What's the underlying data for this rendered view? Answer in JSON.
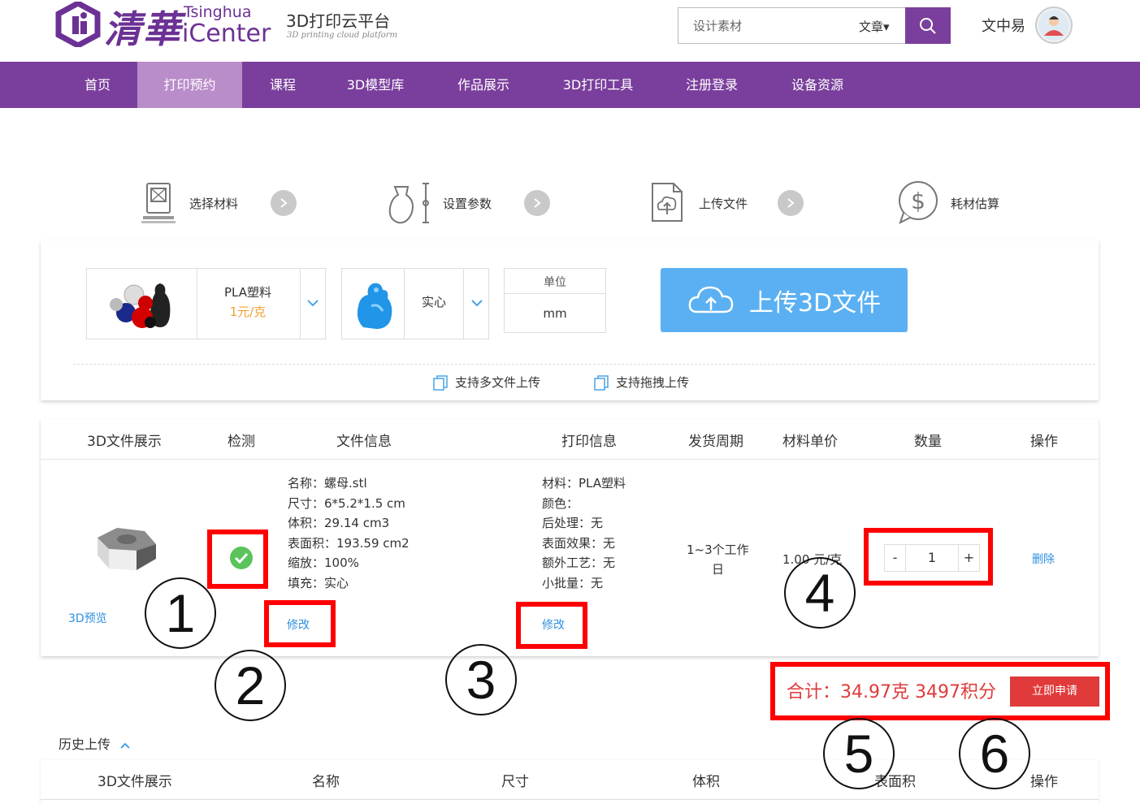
{
  "header": {
    "logo_cn": "清華",
    "logo_en_top": "Tsinghua",
    "logo_en_bottom": "iCenter",
    "platform_title": "3D打印云平台",
    "platform_subtitle": "3D printing cloud platform",
    "search_placeholder": "设计素材",
    "search_category": "文章▾",
    "user_name": "文中易"
  },
  "nav": {
    "items": [
      {
        "label": "首页"
      },
      {
        "label": "打印预约"
      },
      {
        "label": "课程"
      },
      {
        "label": "3D模型库"
      },
      {
        "label": "作品展示"
      },
      {
        "label": "3D打印工具"
      },
      {
        "label": "注册登录"
      },
      {
        "label": "设备资源"
      }
    ],
    "active_index": 1
  },
  "steps": [
    {
      "label": "选择材料",
      "icon": "printer-icon"
    },
    {
      "label": "设置参数",
      "icon": "vase-settings-icon"
    },
    {
      "label": "上传文件",
      "icon": "file-upload-icon"
    },
    {
      "label": "耗材估算",
      "icon": "dollar-bubble-icon"
    }
  ],
  "config": {
    "material_name": "PLA塑料",
    "material_price": "1元/克",
    "fill_mode": "实心",
    "unit_label": "单位",
    "unit_value": "mm",
    "upload_button": "上传3D文件",
    "hint_multi": "支持多文件上传",
    "hint_drag": "支持拖拽上传"
  },
  "table": {
    "headers": [
      "3D文件展示",
      "检测",
      "文件信息",
      "打印信息",
      "发货周期",
      "材料单价",
      "数量",
      "操作"
    ],
    "row": {
      "file_info": [
        "名称：螺母.stl",
        "尺寸：6*5.2*1.5 cm",
        "体积：29.14 cm3",
        "表面积：193.59 cm2",
        "缩放：100%",
        "填充：实心"
      ],
      "print_info": [
        "材料：PLA塑料",
        "颜色：",
        "后处理：无",
        "表面效果：无",
        "额外工艺：无",
        "小批量：无"
      ],
      "delivery_line1": "1~3个工作",
      "delivery_line2": "日",
      "unit_price": "1.00 元/克",
      "quantity": "1",
      "minus": "-",
      "plus": "+",
      "preview_link": "3D预览",
      "edit_file": "修改",
      "edit_print": "修改",
      "delete": "删除"
    }
  },
  "summary": {
    "total": "合计：34.97克 3497积分",
    "apply_button": "立即申请"
  },
  "history": {
    "title": "历史上传",
    "headers": [
      "3D文件展示",
      "名称",
      "尺寸",
      "体积",
      "表面积",
      "操作"
    ]
  },
  "annotations": [
    "1",
    "2",
    "3",
    "4",
    "5",
    "6"
  ],
  "colors": {
    "brand_purple": "#7a3f9c",
    "nav_active": "#b98dc9",
    "upload_blue": "#5ab0f2",
    "link_blue": "#2f8fe0",
    "alert_red": "#e03a3a",
    "annotation_red": "#ff0000",
    "check_green": "#5bc35b"
  }
}
